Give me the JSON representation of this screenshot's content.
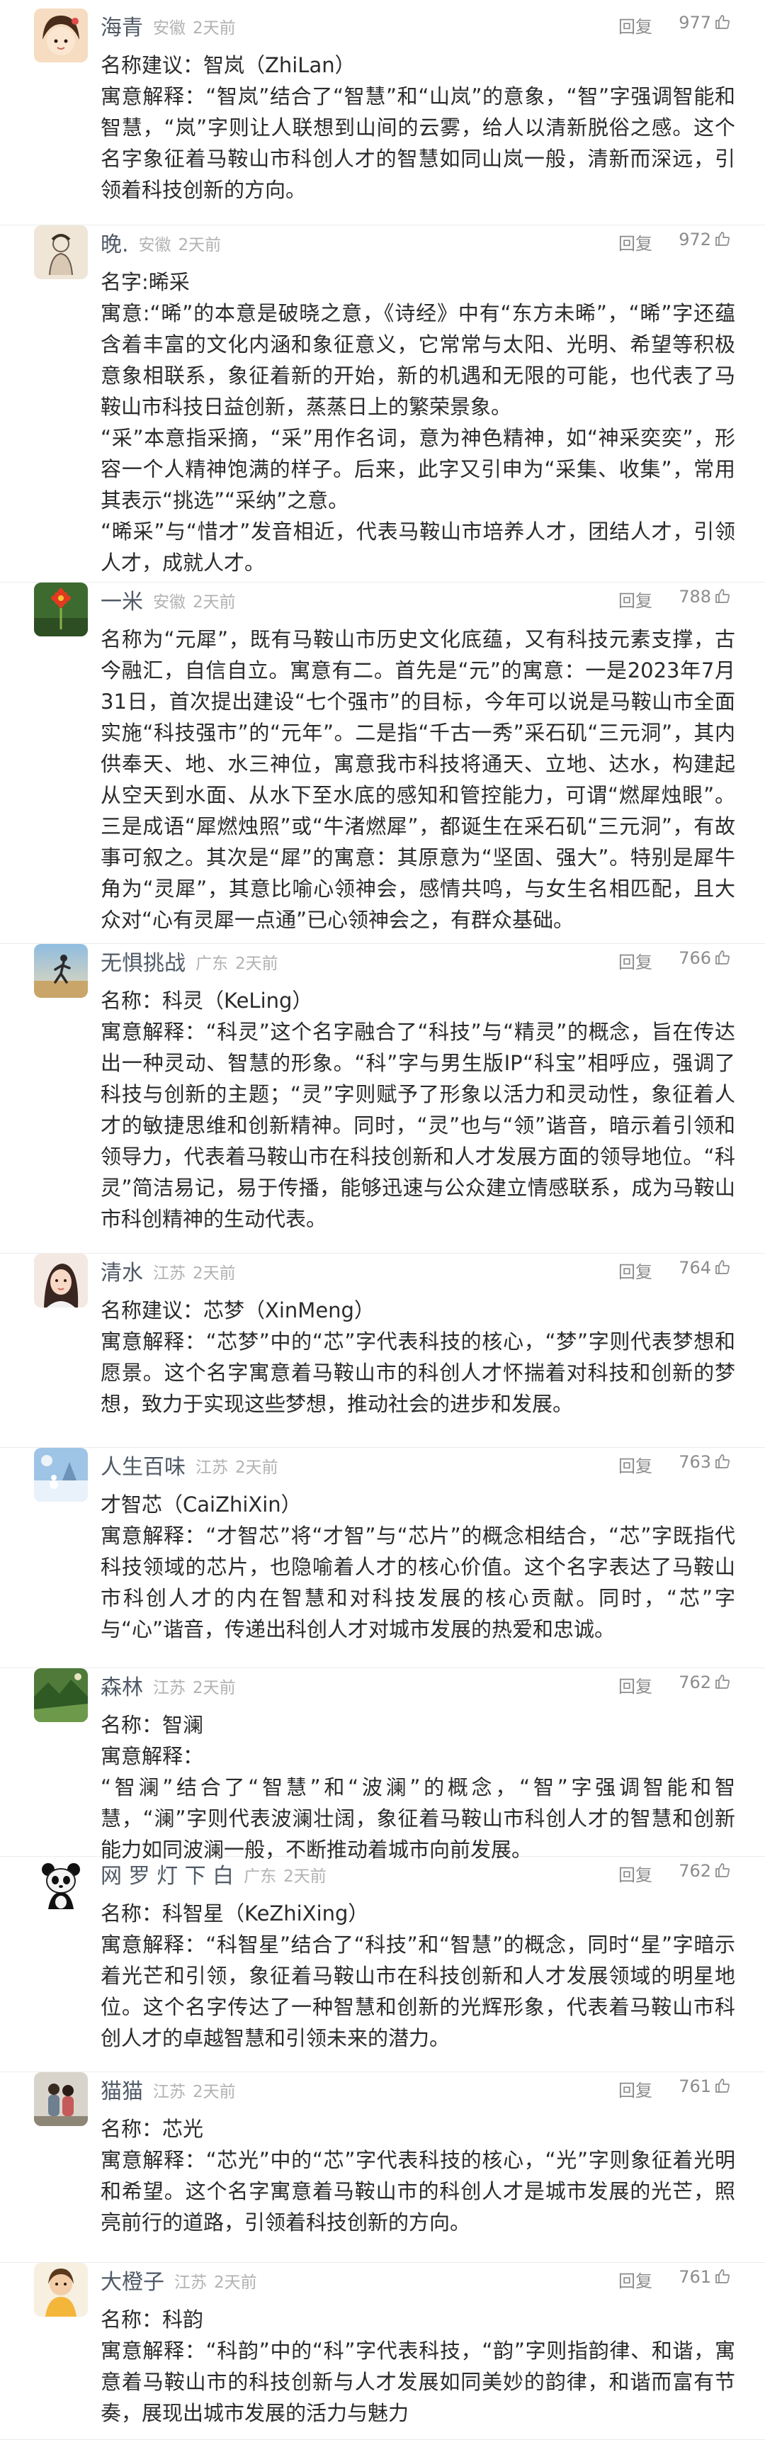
{
  "reply_label": "回复",
  "comments": [
    {
      "username": "海青",
      "location": "安徽",
      "time": "2天前",
      "likes": "977",
      "avatar_icon": "cartoon-girl-avatar",
      "paragraphs": [
        "名称建议：智岚（ZhiLan）",
        "寓意解释：“智岚”结合了“智慧”和“山岚”的意象，“智”字强调智能和智慧，“岚”字则让人联想到山间的云雾，给人以清新脱俗之感。这个名字象征着马鞍山市科创人才的智慧如同山岚一般，清新而深远，引领着科技创新的方向。"
      ]
    },
    {
      "username": "晚.",
      "location": "安徽",
      "time": "2天前",
      "likes": "972",
      "avatar_icon": "sketch-figure-avatar",
      "paragraphs": [
        "名字:晞采",
        "寓意:“晞”的本意是破晓之意，《诗经》中有“东方未晞”，“晞”字还蕴含着丰富的文化内涵和象征意义，它常常与太阳、光明、希望等积极意象相联系，象征着新的开始，新的机遇和无限的可能，也代表了马鞍山市科技日益创新，蒸蒸日上的繁荣景象。",
        "“采”本意指采摘，“采”用作名词，意为神色精神，如“神采奕奕”，形容一个人精神饱满的样子。后来，此字又引申为“采集、收集”，常用其表示“挑选”“采纳”之意。",
        "“晞采”与“惜才”发音相近，代表马鞍山市培养人才，团结人才，引领人才，成就人才。"
      ]
    },
    {
      "username": "一米",
      "location": "安徽",
      "time": "2天前",
      "likes": "788",
      "avatar_icon": "flower-avatar",
      "paragraphs": [
        "名称为“元犀”，既有马鞍山市历史文化底蕴，又有科技元素支撑，古今融汇，自信自立。寓意有二。首先是“元”的寓意：一是2023年7月31日，首次提出建设“七个强市”的目标，今年可以说是马鞍山市全面实施“科技强市”的“元年”。二是指“千古一秀”采石矶“三元洞”，其内供奉天、地、水三神位，寓意我市科技将通天、立地、达水，构建起从空天到水面、从水下至水底的感知和管控能力，可谓“燃犀烛眼”。三是成语“犀燃烛照”或“牛渚燃犀”，都诞生在采石矶“三元洞”，有故事可叙之。其次是“犀”的寓意：其原意为“坚固、强大”。特别是犀牛角为“灵犀”，其意比喻心领神会，感情共鸣，与女生名相匹配，且大众对“心有灵犀一点通”已心领神会之，有群众基础。"
      ]
    },
    {
      "username": "无惧挑战",
      "location": "广东",
      "time": "2天前",
      "likes": "766",
      "avatar_icon": "runner-avatar",
      "paragraphs": [
        "名称：科灵（KeLing）",
        "寓意解释：“科灵”这个名字融合了“科技”与“精灵”的概念，旨在传达出一种灵动、智慧的形象。“科”字与男生版IP“科宝”相呼应，强调了科技与创新的主题；“灵”字则赋予了形象以活力和灵动性，象征着人才的敏捷思维和创新精神。同时，“灵”也与“领”谐音，暗示着引领和领导力，代表着马鞍山市在科技创新和人才发展方面的领导地位。“科灵”简洁易记，易于传播，能够迅速与公众建立情感联系，成为马鞍山市科创精神的生动代表。"
      ]
    },
    {
      "username": "清水",
      "location": "江苏",
      "time": "2天前",
      "likes": "764",
      "avatar_icon": "woman-portrait-avatar",
      "paragraphs": [
        "名称建议：芯梦（XinMeng）",
        "寓意解释：“芯梦”中的“芯”字代表科技的核心，“梦”字则代表梦想和愿景。这个名字寓意着马鞍山市的科创人才怀揣着对科技和创新的梦想，致力于实现这些梦想，推动社会的进步和发展。"
      ]
    },
    {
      "username": "人生百味",
      "location": "江苏",
      "time": "2天前",
      "likes": "763",
      "avatar_icon": "snow-scene-avatar",
      "paragraphs": [
        "才智芯（CaiZhiXin）",
        "寓意解释：“才智芯”将“才智”与“芯片”的概念相结合，“芯”字既指代科技领域的芯片，也隐喻着人才的核心价值。这个名字表达了马鞍山市科创人才的内在智慧和对科技发展的核心贡献。同时，“芯”字与“心”谐音，传递出科创人才对城市发展的热爱和忠诚。"
      ]
    },
    {
      "username": "森林",
      "location": "江苏",
      "time": "2天前",
      "likes": "762",
      "avatar_icon": "landscape-avatar",
      "paragraphs": [
        "名称：智澜",
        "寓意解释：",
        "“智澜”结合了“智慧”和“波澜”的概念，“智”字强调智能和智慧，“澜”字则代表波澜壮阔，象征着马鞍山市科创人才的智慧和创新能力如同波澜一般，不断推动着城市向前发展。"
      ]
    },
    {
      "username": "网 罗 灯 下 白",
      "location": "广东",
      "time": "2天前",
      "likes": "762",
      "avatar_icon": "panda-avatar",
      "paragraphs": [
        "名称：科智星（KeZhiXing）",
        "寓意解释：“科智星”结合了“科技”和“智慧”的概念，同时“星”字暗示着光芒和引领，象征着马鞍山市在科技创新和人才发展领域的明星地位。这个名字传达了一种智慧和创新的光辉形象，代表着马鞍山市科创人才的卓越智慧和引领未来的潜力。"
      ]
    },
    {
      "username": "猫猫",
      "location": "江苏",
      "time": "2天前",
      "likes": "761",
      "avatar_icon": "couple-photo-avatar",
      "paragraphs": [
        "名称：芯光",
        "寓意解释：“芯光”中的“芯”字代表科技的核心，“光”字则象征着光明和希望。这个名字寓意着马鞍山市的科创人才是城市发展的光芒，照亮前行的道路，引领着科技创新的方向。"
      ]
    },
    {
      "username": "大橙子",
      "location": "江苏",
      "time": "2天前",
      "likes": "761",
      "avatar_icon": "girl-photo-avatar",
      "paragraphs": [
        "名称：科韵",
        "寓意解释：“科韵”中的“科”字代表科技，“韵”字则指韵律、和谐，寓意着马鞍山市的科技创新与人才发展如同美妙的韵律，和谐而富有节奏，展现出城市发展的活力与魅力"
      ]
    }
  ]
}
